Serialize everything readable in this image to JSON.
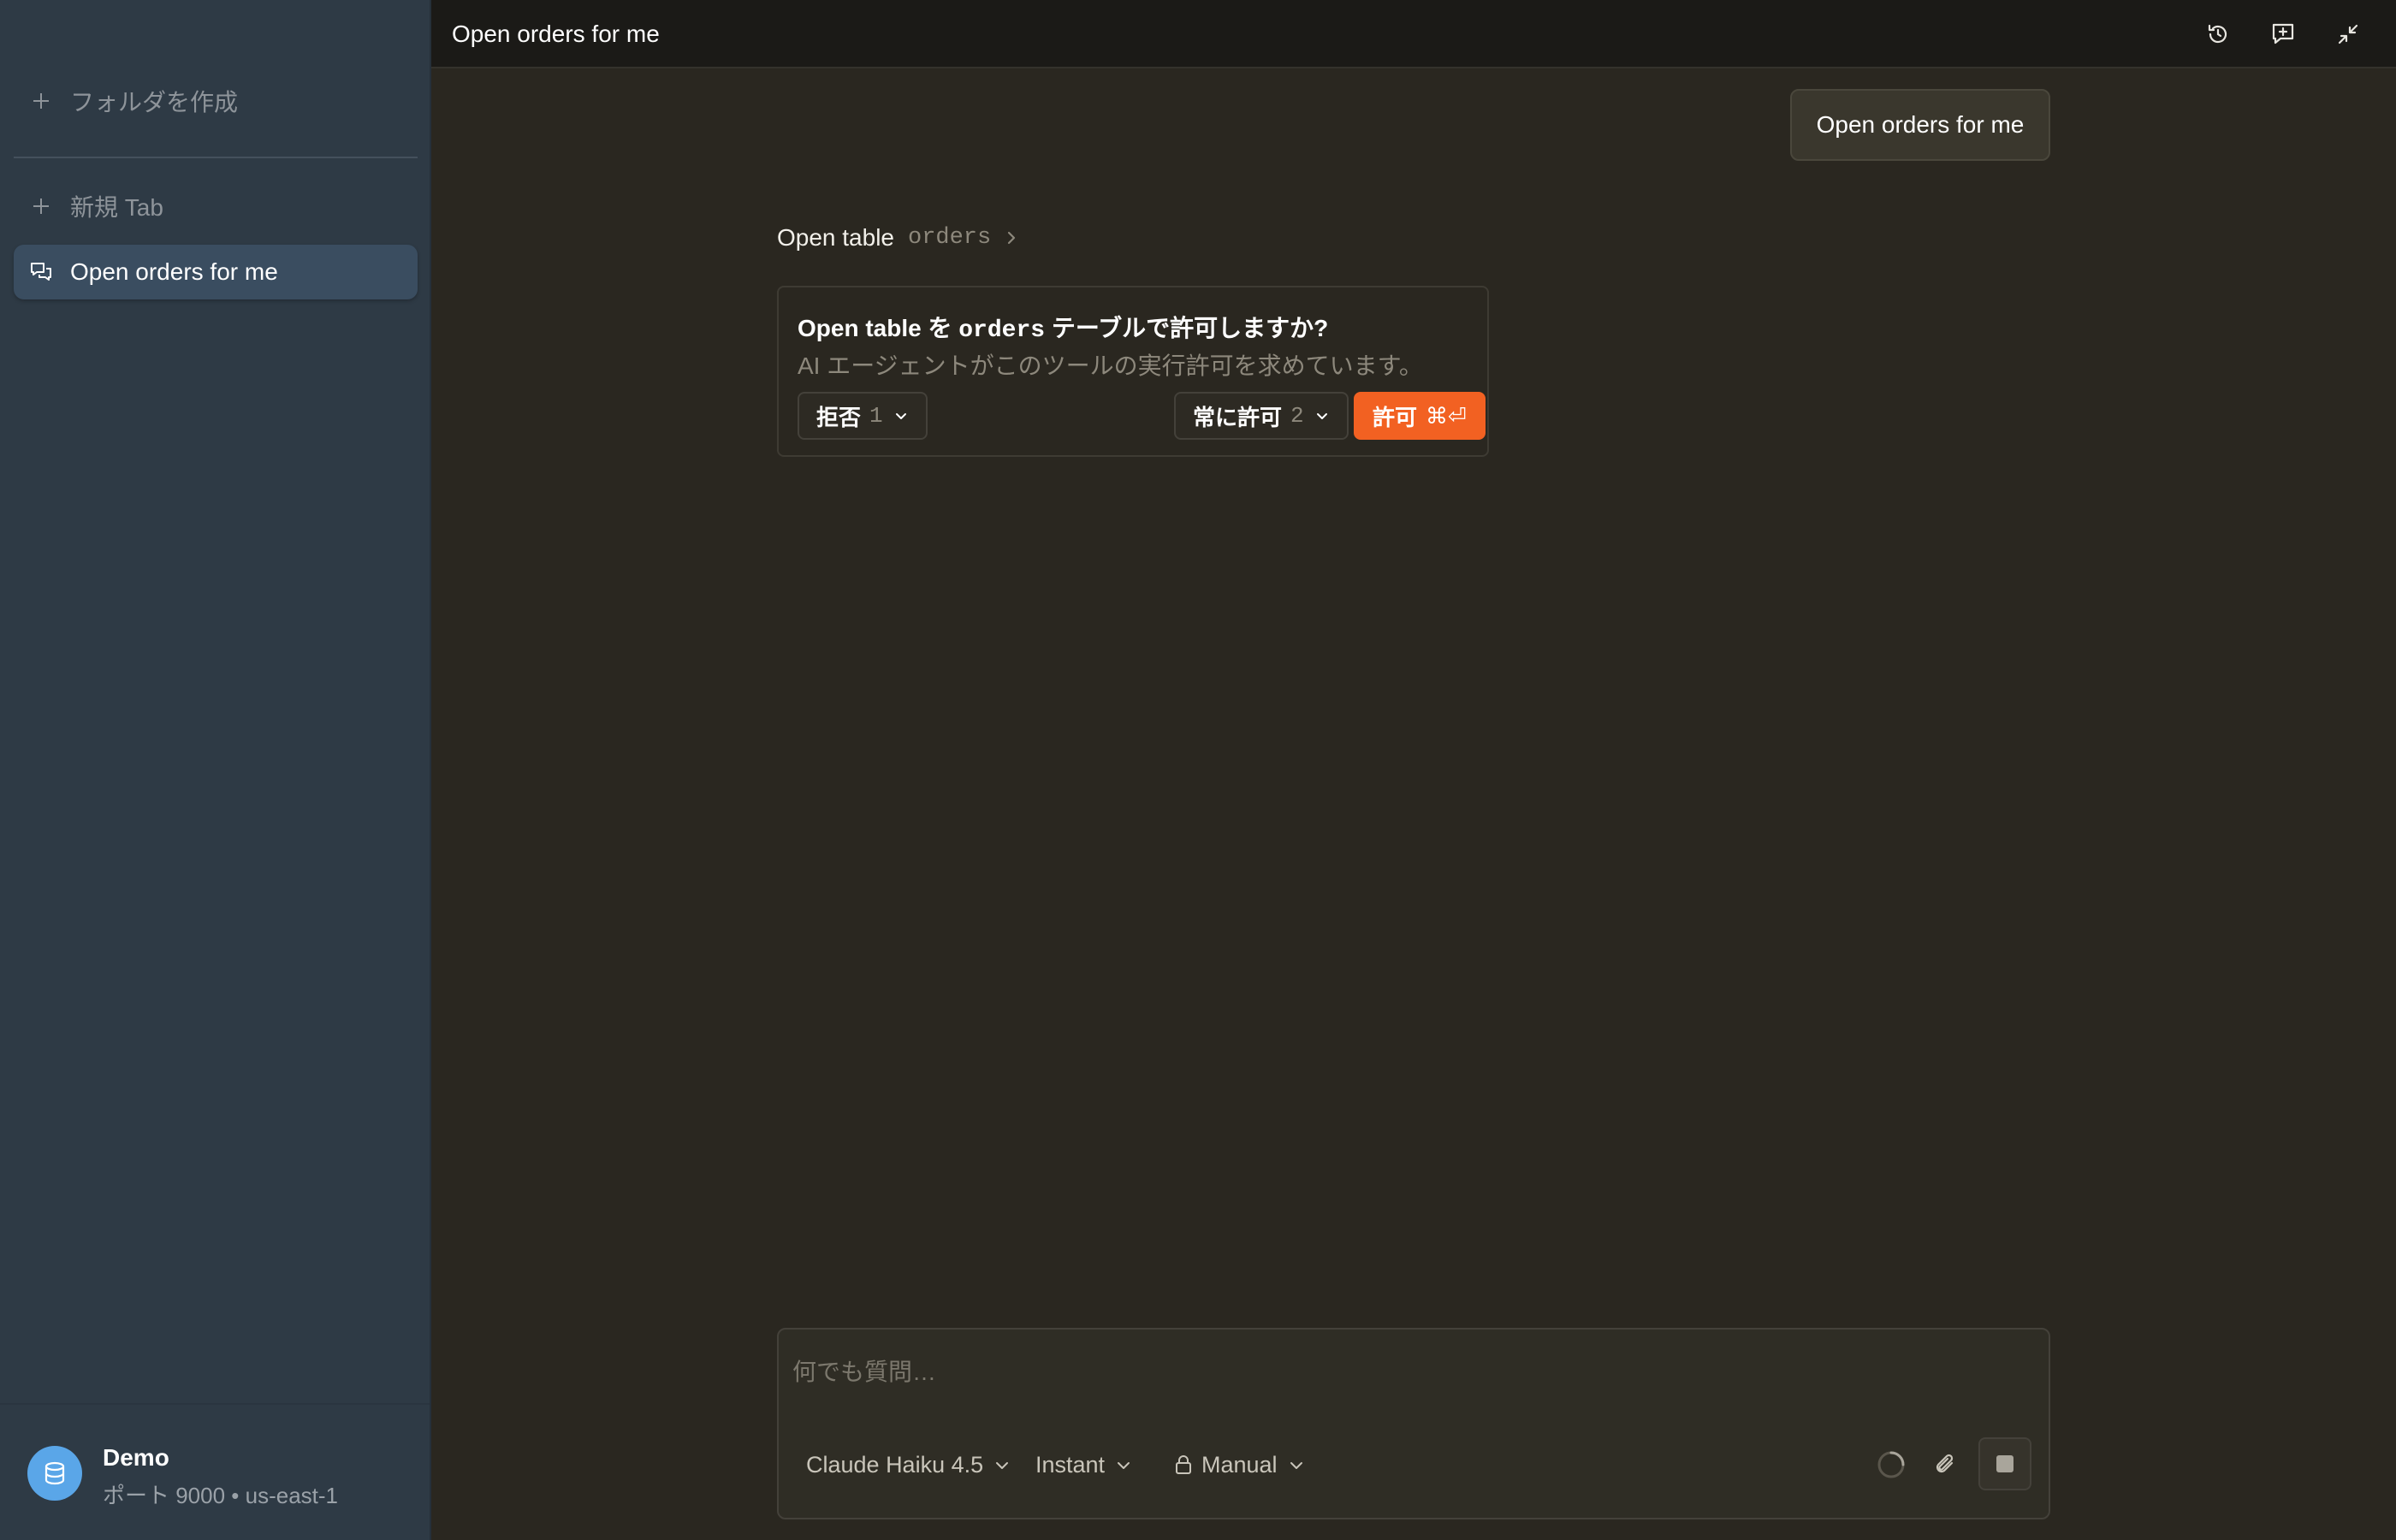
{
  "sidebar": {
    "create_folder": "フォルダを作成",
    "new_tab": "新規 Tab",
    "conversations": [
      {
        "label": "Open orders for me",
        "active": true
      }
    ]
  },
  "account": {
    "name": "Demo",
    "details": "ポート 9000 • us-east-1"
  },
  "header": {
    "title": "Open orders for me",
    "icons": [
      "history-icon",
      "new-chat-icon",
      "collapse-icon"
    ]
  },
  "chat": {
    "user_message": "Open orders for me",
    "tool_call": {
      "name": "Open table",
      "arg": "orders"
    },
    "permission": {
      "title_pre": "Open table を ",
      "title_code": "orders",
      "title_post": " テーブルで許可しますか?",
      "description": "AI エージェントがこのツールの実行許可を求めています。",
      "deny_label": "拒否",
      "deny_shortcut": "1",
      "always_label": "常に許可",
      "always_shortcut": "2",
      "allow_label": "許可",
      "allow_shortcut": "⌘⏎"
    }
  },
  "composer": {
    "placeholder": "何でも質問…",
    "model": "Claude Haiku 4.5",
    "mode": "Instant",
    "approval": "Manual"
  },
  "colors": {
    "accent": "#f26122",
    "sidebar_bg": "#2e3a45",
    "main_bg": "#2a2720",
    "avatar": "#5aa6e8"
  }
}
